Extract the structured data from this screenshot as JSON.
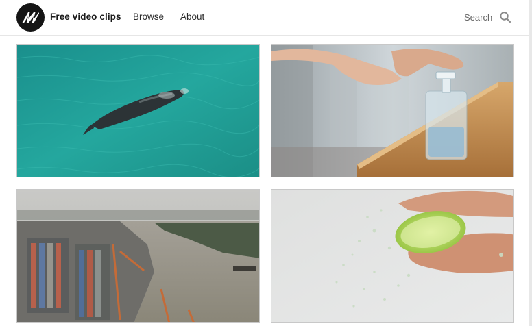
{
  "header": {
    "brand": "Free video clips",
    "nav": [
      {
        "label": "Browse"
      },
      {
        "label": "About"
      }
    ],
    "search": {
      "label": "Search",
      "icon": "search-icon"
    }
  },
  "clips": [
    {
      "subject": "whale",
      "icon": "aerial-whale-thumbnail"
    },
    {
      "subject": "hand sanitizer",
      "icon": "hand-sanitizer-thumbnail"
    },
    {
      "subject": "port",
      "icon": "container-port-thumbnail"
    },
    {
      "subject": "lime",
      "icon": "lime-squeeze-thumbnail"
    }
  ],
  "colors": {
    "logo_bg": "#151515",
    "sea": "#1f9a94",
    "text": "#222222",
    "muted": "#666666"
  }
}
